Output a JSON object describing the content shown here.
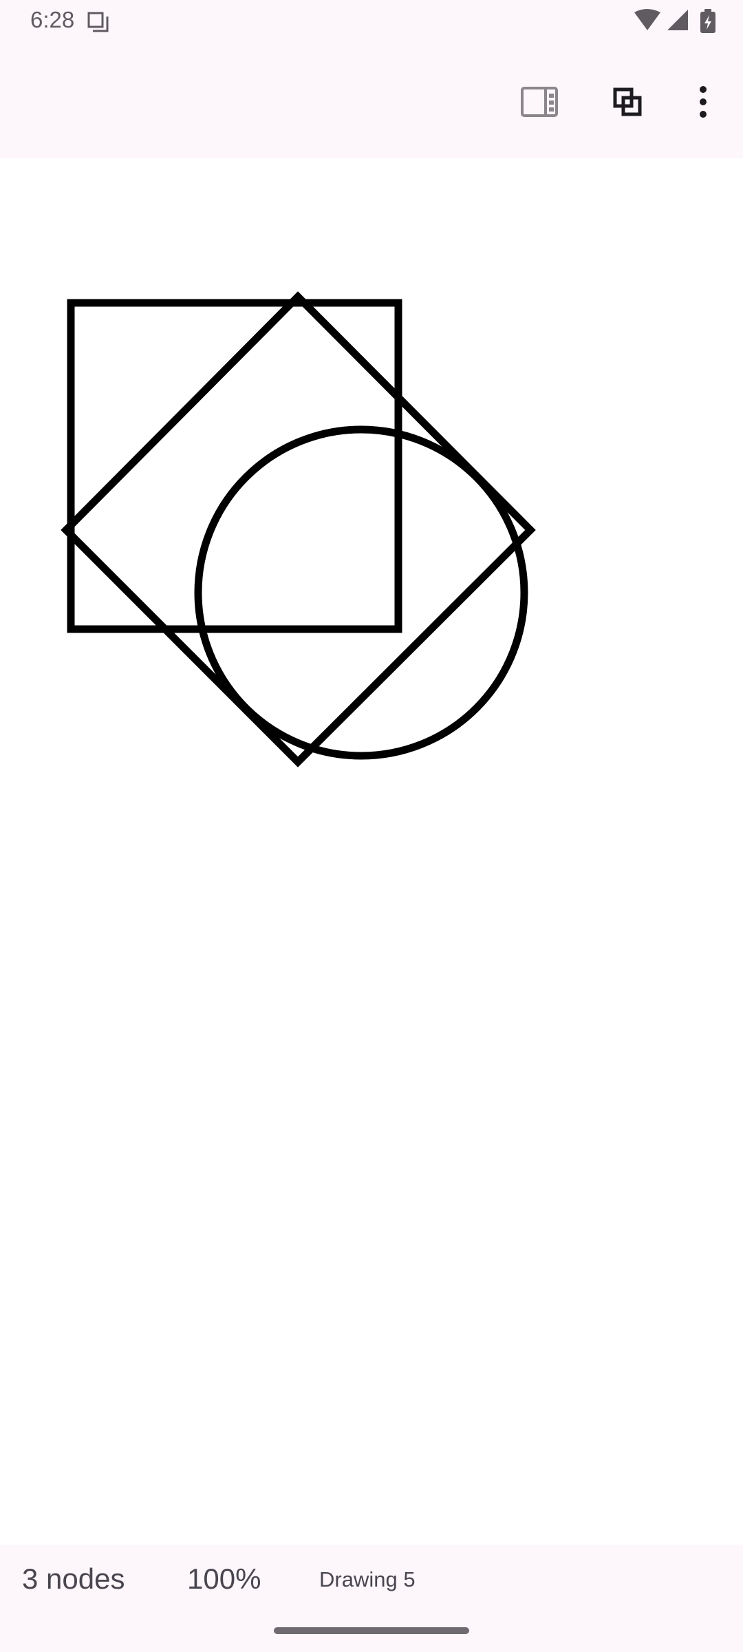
{
  "status_bar": {
    "time": "6:28",
    "icons": [
      "notification-copy-icon",
      "wifi-icon",
      "signal-icon",
      "battery-charging-icon"
    ]
  },
  "app_bar": {
    "actions": [
      {
        "name": "side-panel-icon"
      },
      {
        "name": "layers-icon"
      },
      {
        "name": "more-options-icon"
      }
    ]
  },
  "canvas": {
    "shapes": [
      {
        "kind": "rectangle"
      },
      {
        "kind": "diamond"
      },
      {
        "kind": "circle"
      }
    ],
    "stroke_color": "#000000"
  },
  "bottom_bar": {
    "node_count": "3 nodes",
    "zoom": "100%",
    "drawing_name": "Drawing 5"
  },
  "colors": {
    "surface": "#fdf7fc",
    "canvas": "#ffffff",
    "on_surface_variant": "#4a4650"
  }
}
